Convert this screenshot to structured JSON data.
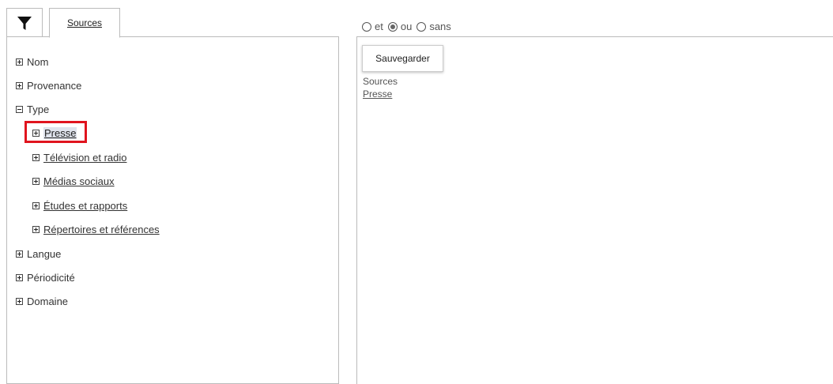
{
  "tabs": {
    "filter_icon": "funnel-icon",
    "sources_label": "Sources"
  },
  "tree": {
    "items": [
      {
        "label": "Nom",
        "expanded": false
      },
      {
        "label": "Provenance",
        "expanded": false
      },
      {
        "label": "Type",
        "expanded": true,
        "children": [
          {
            "label": "Presse",
            "selected": true
          },
          {
            "label": "Télévision et radio"
          },
          {
            "label": "Médias sociaux"
          },
          {
            "label": "Études et rapports"
          },
          {
            "label": "Répertoires et références"
          }
        ]
      },
      {
        "label": "Langue",
        "expanded": false
      },
      {
        "label": "Périodicité",
        "expanded": false
      },
      {
        "label": "Domaine",
        "expanded": false
      }
    ]
  },
  "operators": {
    "options": [
      "et",
      "ou",
      "sans"
    ],
    "selected": "ou"
  },
  "actions": {
    "save_label": "Sauvegarder"
  },
  "summary": {
    "title": "Sources",
    "value": "Presse"
  },
  "colors": {
    "highlight_border": "#e0141e",
    "selection_bg": "#dfe3ec"
  }
}
